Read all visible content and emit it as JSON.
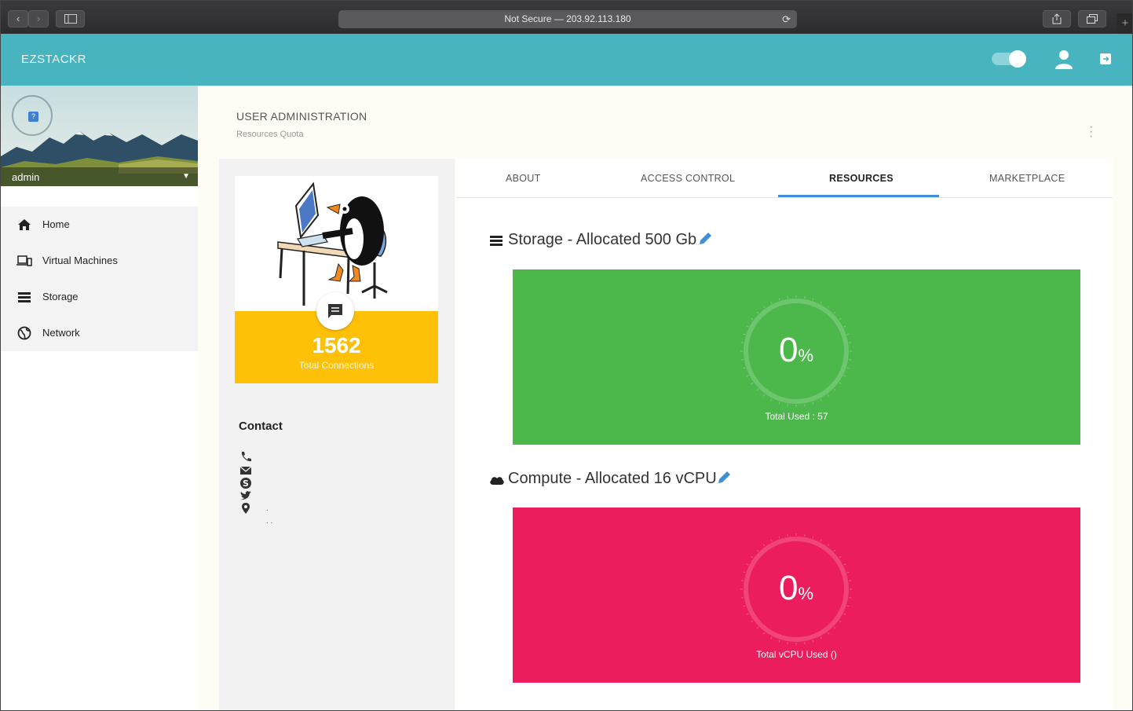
{
  "browser": {
    "address": "Not Secure — 203.92.113.180"
  },
  "app": {
    "brand": "EZSTACKR"
  },
  "sidebar": {
    "username": "admin",
    "items": [
      {
        "label": "Home",
        "icon": "home-icon"
      },
      {
        "label": "Virtual Machines",
        "icon": "devices-icon"
      },
      {
        "label": "Storage",
        "icon": "storage-icon"
      },
      {
        "label": "Network",
        "icon": "globe-icon"
      }
    ]
  },
  "page": {
    "title": "USER ADMINISTRATION",
    "subtitle": "Resources Quota"
  },
  "profile": {
    "connections": "1562",
    "connections_label": "Total Connections",
    "contact_heading": "Contact",
    "contact_marks": [
      ".",
      ". ."
    ]
  },
  "tabs": [
    {
      "label": "ABOUT",
      "active": false
    },
    {
      "label": "ACCESS CONTROL",
      "active": false
    },
    {
      "label": "RESOURCES",
      "active": true
    },
    {
      "label": "MARKETPLACE",
      "active": false
    }
  ],
  "storage": {
    "title": "Storage - Allocated 500 Gb",
    "value": "0",
    "unit": "%",
    "percent": 0,
    "label": "Total Used : 57",
    "color": "#4cb84c"
  },
  "compute": {
    "title": "Compute - Allocated 16 vCPU",
    "value": "0",
    "unit": "%",
    "percent": 0,
    "label": "Total vCPU Used ()",
    "color": "#eb1d5c"
  },
  "colors": {
    "appbar": "#47b4c0",
    "accent": "#3d8fd8",
    "connections_card": "#ffc107"
  }
}
